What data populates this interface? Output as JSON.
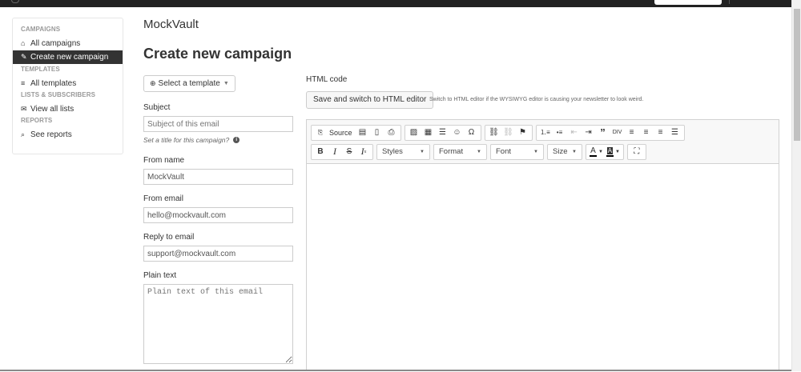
{
  "sidebar": {
    "sections": [
      {
        "heading": "CAMPAIGNS",
        "items": [
          {
            "label": "All campaigns",
            "icon": "home-icon",
            "glyph": "⌂",
            "active": false
          },
          {
            "label": "Create new campaign",
            "icon": "edit-icon",
            "glyph": "✎",
            "active": true
          }
        ]
      },
      {
        "heading": "TEMPLATES",
        "items": [
          {
            "label": "All templates",
            "icon": "list-icon",
            "glyph": "≡",
            "active": false
          }
        ]
      },
      {
        "heading": "LISTS & SUBSCRIBERS",
        "items": [
          {
            "label": "View all lists",
            "icon": "envelope-icon",
            "glyph": "✉",
            "active": false
          }
        ]
      },
      {
        "heading": "REPORTS",
        "items": [
          {
            "label": "See reports",
            "icon": "search-icon",
            "glyph": "⌕",
            "active": false
          }
        ]
      }
    ]
  },
  "header": {
    "brand": "MockVault",
    "title": "Create new campaign"
  },
  "form": {
    "template_button": "Select a template",
    "subject_label": "Subject",
    "subject_placeholder": "Subject of this email",
    "subject_hint": "Set a title for this campaign?",
    "from_name_label": "From name",
    "from_name_value": "MockVault",
    "from_email_label": "From email",
    "from_email_value": "hello@mockvault.com",
    "reply_to_label": "Reply to email",
    "reply_to_value": "support@mockvault.com",
    "plain_text_label": "Plain text",
    "plain_text_placeholder": "Plain text of this email"
  },
  "editor": {
    "html_code_label": "HTML code",
    "save_switch_button": "Save and switch to HTML editor",
    "switch_hint": "Switch to HTML editor if the WYSIWYG editor is causing your newsletter to look weird.",
    "source_label": "Source",
    "combos": {
      "styles": "Styles",
      "format": "Format",
      "font": "Font",
      "size": "Size"
    }
  }
}
